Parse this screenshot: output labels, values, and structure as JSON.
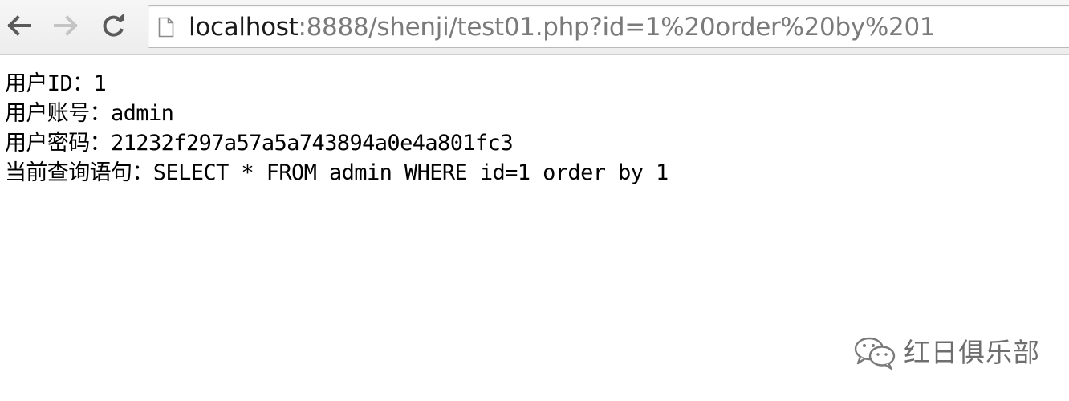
{
  "browser": {
    "url_host": "localhost",
    "url_rest": ":8888/shenji/test01.php?id=1%20order%20by%201",
    "icons": {
      "back": "back-arrow-icon",
      "forward": "forward-arrow-icon",
      "reload": "reload-icon",
      "page": "page-icon"
    }
  },
  "page": {
    "lines": [
      "用户ID：1",
      "用户账号：admin",
      "用户密码：21232f297a57a5a743894a0e4a801fc3",
      "当前查询语句：SELECT * FROM admin WHERE id=1 order by 1"
    ]
  },
  "watermark": {
    "text": "红日俱乐部",
    "icon": "wechat-icon"
  }
}
